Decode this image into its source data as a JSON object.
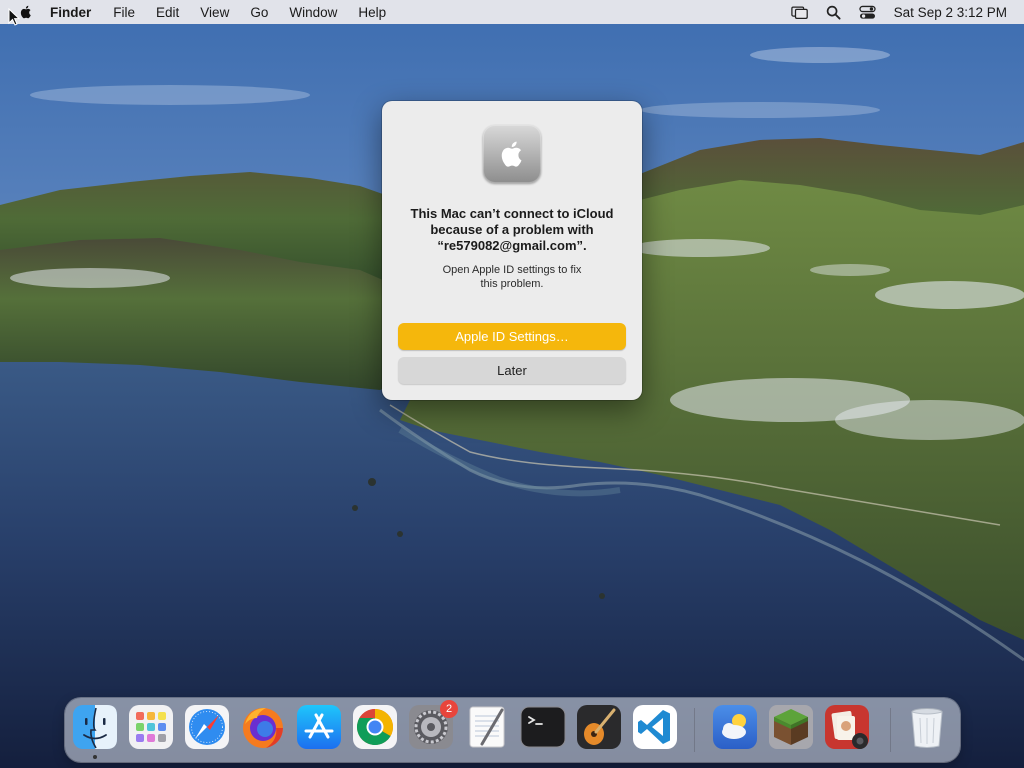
{
  "menubar": {
    "app_name": "Finder",
    "items": [
      "File",
      "Edit",
      "View",
      "Go",
      "Window",
      "Help"
    ],
    "status_icons": [
      "screen-mirroring-icon",
      "spotlight-search-icon",
      "control-center-icon"
    ],
    "clock": "Sat Sep 2  3:12 PM"
  },
  "dialog": {
    "icon": "apple-logo-icon",
    "title_lines": [
      "This Mac can’t connect to iCloud",
      "because of a problem with",
      "“re579082@gmail.com”."
    ],
    "body_lines": [
      "Open Apple ID settings to fix",
      "this problem."
    ],
    "primary_button": "Apple ID Settings…",
    "secondary_button": "Later",
    "accent_color": "#f5b70c"
  },
  "dock": {
    "apps": [
      {
        "name": "finder",
        "icon": "finder-icon",
        "running": true
      },
      {
        "name": "launchpad",
        "icon": "launchpad-icon",
        "running": false
      },
      {
        "name": "safari",
        "icon": "safari-icon",
        "running": false
      },
      {
        "name": "firefox",
        "icon": "firefox-icon",
        "running": false
      },
      {
        "name": "app-store",
        "icon": "app-store-icon",
        "running": false
      },
      {
        "name": "chrome",
        "icon": "chrome-icon",
        "running": false
      },
      {
        "name": "system-preferences",
        "icon": "gear-icon",
        "running": false,
        "badge": "2"
      },
      {
        "name": "textedit",
        "icon": "textedit-icon",
        "running": false
      },
      {
        "name": "terminal",
        "icon": "terminal-icon",
        "running": false
      },
      {
        "name": "garageband",
        "icon": "guitar-icon",
        "running": false
      },
      {
        "name": "vscode",
        "icon": "vscode-icon",
        "running": false
      },
      {
        "name": "weather",
        "icon": "weather-icon",
        "running": false
      },
      {
        "name": "minecraft",
        "icon": "minecraft-icon",
        "running": false
      },
      {
        "name": "photo-booth",
        "icon": "photo-booth-icon",
        "running": false
      },
      {
        "name": "trash",
        "icon": "trash-icon",
        "running": false
      }
    ]
  }
}
